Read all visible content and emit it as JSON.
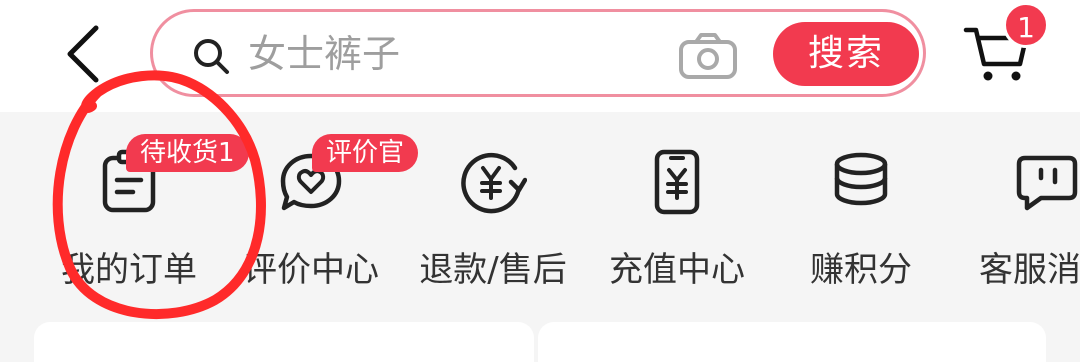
{
  "header": {
    "search": {
      "placeholder": "女士裤子",
      "button_label": "搜索"
    },
    "cart": {
      "badge_count": "1"
    }
  },
  "quick_menu": {
    "items": [
      {
        "label": "我的订单",
        "icon": "clipboard-icon",
        "badge": "待收货1"
      },
      {
        "label": "评价中心",
        "icon": "heart-chat-icon",
        "badge": "评价官"
      },
      {
        "label": "退款/售后",
        "icon": "yuan-refund-icon"
      },
      {
        "label": "充值中心",
        "icon": "phone-yuan-icon"
      },
      {
        "label": "赚积分",
        "icon": "coin-stack-icon"
      },
      {
        "label": "客服消息",
        "icon": "service-message-icon"
      }
    ]
  },
  "colors": {
    "accent": "#f23a4f",
    "search_border": "#f08fa0",
    "annotation": "#ff2a2a"
  }
}
